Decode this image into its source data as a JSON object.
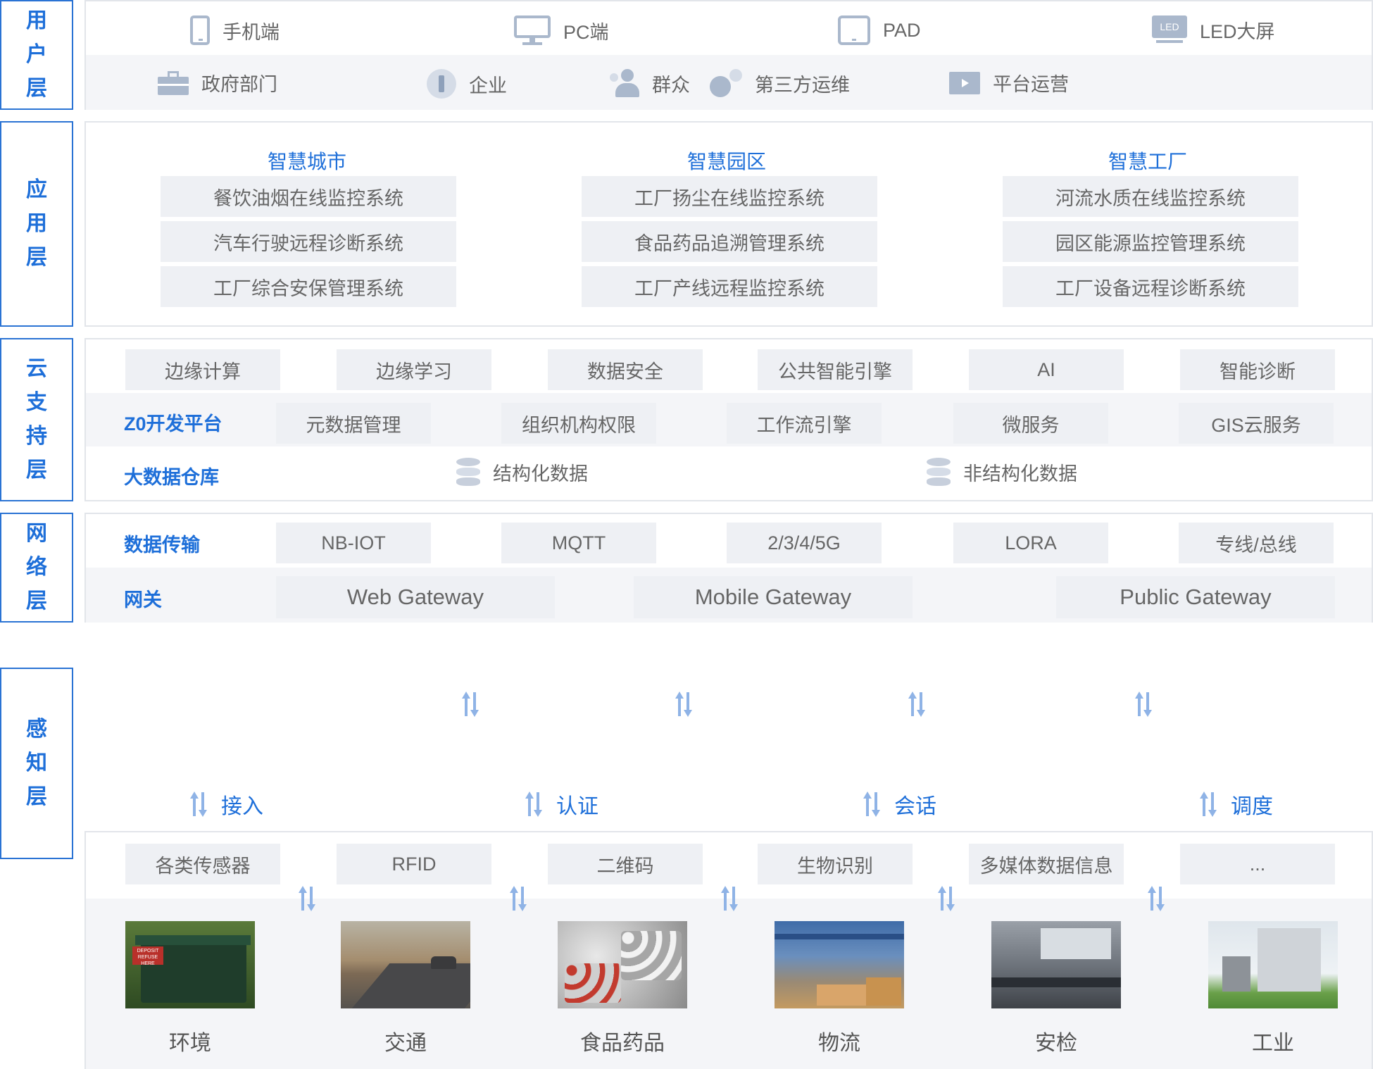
{
  "layers": {
    "user": "用户层",
    "app": "应用层",
    "cloud": "云支持层",
    "network": "网络层",
    "perception": "感知层"
  },
  "user_layer": {
    "devices": [
      "手机端",
      "PC端",
      "PAD",
      "LED大屏"
    ],
    "led_icon_text": "LED",
    "roles": [
      "政府部门",
      "企业",
      "群众",
      "第三方运维",
      "平台运营"
    ]
  },
  "app_layer": {
    "groups": [
      {
        "title": "智慧城市",
        "systems": [
          "餐饮油烟在线监控系统",
          "汽车行驶远程诊断系统",
          "工厂综合安保管理系统"
        ]
      },
      {
        "title": "智慧园区",
        "systems": [
          "工厂扬尘在线监控系统",
          "食品药品追溯管理系统",
          "工厂产线远程监控系统"
        ]
      },
      {
        "title": "智慧工厂",
        "systems": [
          "河流水质在线监控系统",
          "园区能源监控管理系统",
          "工厂设备远程诊断系统"
        ]
      }
    ]
  },
  "cloud_layer": {
    "capabilities": [
      "边缘计算",
      "边缘学习",
      "数据安全",
      "公共智能引擎",
      "AI",
      "智能诊断"
    ],
    "dev_platform_label": "Z0开发平台",
    "dev_platform_items": [
      "元数据管理",
      "组织机构权限",
      "工作流引擎",
      "微服务",
      "GIS云服务"
    ],
    "warehouse_label": "大数据仓库",
    "warehouse_items": [
      "结构化数据",
      "非结构化数据"
    ]
  },
  "network_layer": {
    "transport_label": "数据传输",
    "transport_items": [
      "NB-IOT",
      "MQTT",
      "2/3/4/5G",
      "LORA",
      "专线/总线"
    ],
    "gateway_label": "网关",
    "gateways": [
      "Web Gateway",
      "Mobile Gateway",
      "Public Gateway"
    ]
  },
  "connectors": [
    "接入",
    "认证",
    "会话",
    "调度"
  ],
  "perception_layer": {
    "sources": [
      "各类传感器",
      "RFID",
      "二维码",
      "生物识别",
      "多媒体数据信息",
      "..."
    ],
    "scenes": [
      "环境",
      "交通",
      "食品药品",
      "物流",
      "安检",
      "工业"
    ],
    "dumpster_sign": "DEPOSIT REFUSE HERE"
  },
  "colors": {
    "accent": "#1e6fd9",
    "border": "#2a73d4",
    "box": "#eef0f4",
    "band": "#f4f5f8",
    "arrow": "#8fb3e6"
  }
}
